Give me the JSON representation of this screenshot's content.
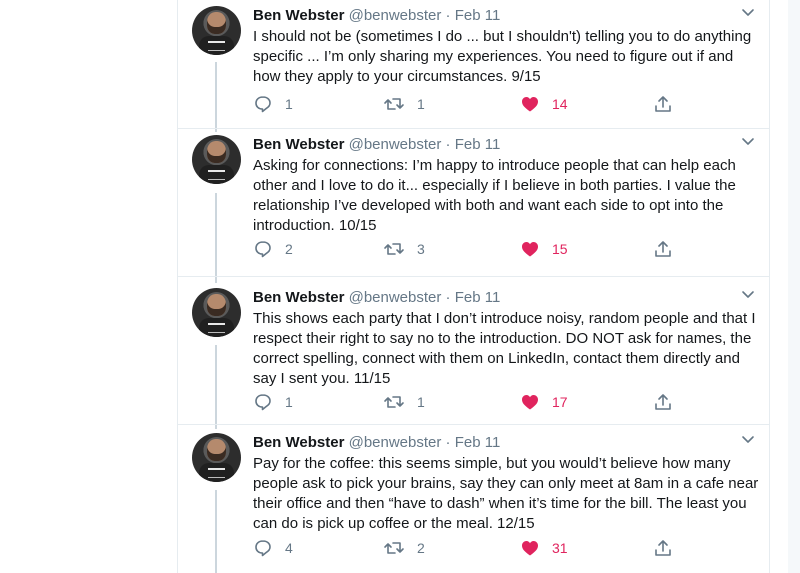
{
  "colors": {
    "like": "#e0245e",
    "muted": "#657786",
    "text": "#14171a",
    "border": "#e6ecf0"
  },
  "tweets": [
    {
      "author": "Ben Webster",
      "handle": "@benwebster",
      "separator": "·",
      "date": "Feb 11",
      "text": "I should not be (sometimes I do ... but I shouldn't) telling you to do anything specific ... I’m only sharing my experiences. You need to figure out if and how they apply to your circumstances. 9/15",
      "replies": "1",
      "retweets": "1",
      "likes": "14"
    },
    {
      "author": "Ben Webster",
      "handle": "@benwebster",
      "separator": "·",
      "date": "Feb 11",
      "text": "Asking for connections: I’m happy to introduce people that can help each other and I love to do it... especially if I believe in both parties. I value the relationship I’ve developed with both and want each side to opt into the introduction.  10/15",
      "replies": "2",
      "retweets": "3",
      "likes": "15"
    },
    {
      "author": "Ben Webster",
      "handle": "@benwebster",
      "separator": "·",
      "date": "Feb 11",
      "text": "This shows each party that I don’t introduce noisy, random people and that I respect their right to say no to the introduction. DO NOT ask for names, the correct spelling, connect with them on LinkedIn, contact them directly and say I sent you. 11/15",
      "replies": "1",
      "retweets": "1",
      "likes": "17"
    },
    {
      "author": "Ben Webster",
      "handle": "@benwebster",
      "separator": "·",
      "date": "Feb 11",
      "text": "Pay for the coffee: this seems simple, but you would’t believe how many people ask to pick your brains, say they can only meet at 8am in a cafe near their office and then “have to dash” when it’s time for the bill. The least you can do is pick up coffee or the meal. 12/15",
      "replies": "4",
      "retweets": "2",
      "likes": "31"
    }
  ]
}
